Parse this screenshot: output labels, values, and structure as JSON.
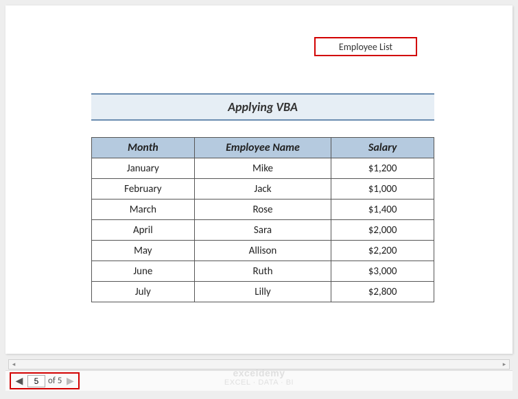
{
  "header": {
    "text": "Employee List"
  },
  "title": "Applying VBA",
  "table": {
    "headers": [
      "Month",
      "Employee Name",
      "Salary"
    ],
    "rows": [
      {
        "month": "January",
        "name": "Mike",
        "salary": "$1,200"
      },
      {
        "month": "February",
        "name": "Jack",
        "salary": "$1,000"
      },
      {
        "month": "March",
        "name": "Rose",
        "salary": "$1,400"
      },
      {
        "month": "April",
        "name": "Sara",
        "salary": "$2,000"
      },
      {
        "month": "May",
        "name": "Allison",
        "salary": "$2,200"
      },
      {
        "month": "June",
        "name": "Ruth",
        "salary": "$3,000"
      },
      {
        "month": "July",
        "name": "Lilly",
        "salary": "$2,800"
      }
    ]
  },
  "pager": {
    "current": "5",
    "of_label": "of 5"
  },
  "watermark": {
    "main": "exceldemy",
    "sub": "EXCEL · DATA · BI"
  }
}
